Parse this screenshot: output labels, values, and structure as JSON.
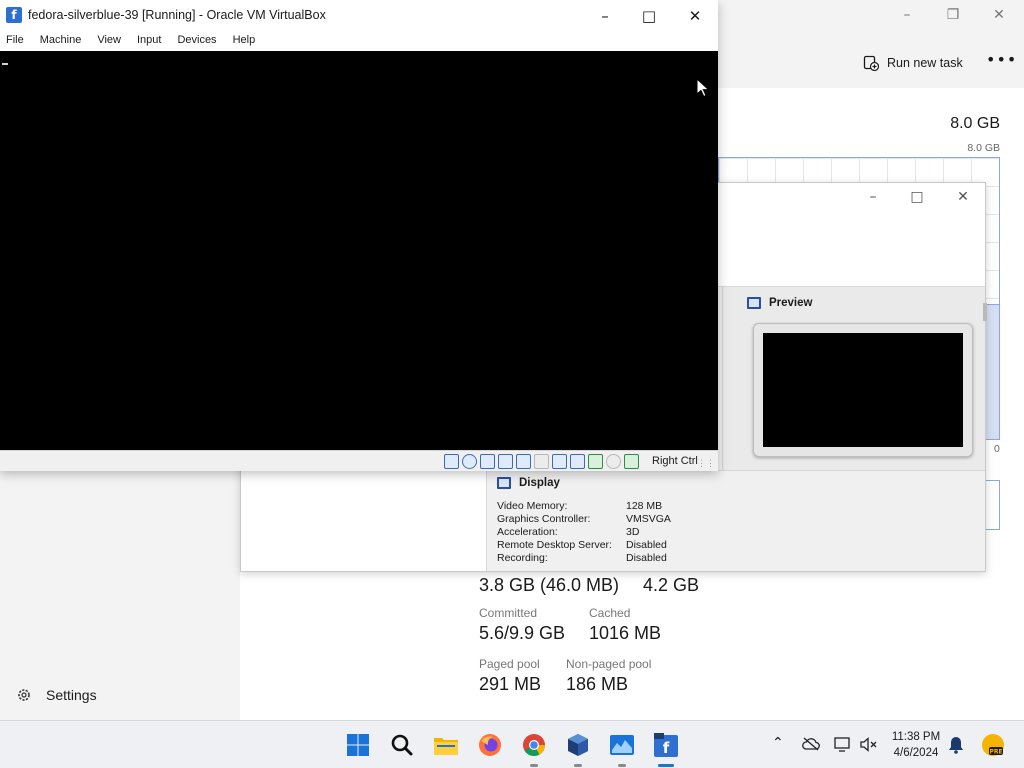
{
  "task_manager": {
    "run_new_task": "Run new task",
    "more_icon": "more-icon",
    "total_memory": "8.0 GB",
    "graph_max": "8.0 GB",
    "graph_min": "0",
    "usage_fraction": 0.48,
    "stats": [
      {
        "label": "",
        "value": "3.8 GB (46.0 MB)"
      },
      {
        "label": "",
        "value": "4.2 GB"
      },
      {
        "label": "Committed",
        "value": "5.6/9.9 GB"
      },
      {
        "label": "Cached",
        "value": "1016 MB"
      },
      {
        "label": "Paged pool",
        "value": "291 MB"
      },
      {
        "label": "Non-paged pool",
        "value": "186 MB"
      }
    ],
    "settings_label": "Settings"
  },
  "vbox_manager": {
    "preview_title": "Preview",
    "display_title": "Display",
    "display_rows": [
      {
        "key": "Video Memory:",
        "value": "128 MB"
      },
      {
        "key": "Graphics Controller:",
        "value": "VMSVGA"
      },
      {
        "key": "Acceleration:",
        "value": "3D"
      },
      {
        "key": "Remote Desktop Server:",
        "value": "Disabled"
      },
      {
        "key": "Recording:",
        "value": "Disabled"
      }
    ]
  },
  "vm_window": {
    "title": "fedora-silverblue-39 [Running] - Oracle VM VirtualBox",
    "menu": [
      "File",
      "Machine",
      "View",
      "Input",
      "Devices",
      "Help"
    ],
    "host_key": "Right Ctrl"
  },
  "taskbar": {
    "time": "11:38 PM",
    "date": "4/6/2024",
    "apps": [
      "start-icon",
      "search-icon",
      "file-explorer-icon",
      "firefox-icon",
      "chrome-icon",
      "virtualbox-icon",
      "task-manager-icon",
      "fedora-vm-icon"
    ]
  },
  "colors": {
    "accent": "#1a73d9",
    "vm_screen": "#000000",
    "graph_line": "#8fa8d6"
  }
}
